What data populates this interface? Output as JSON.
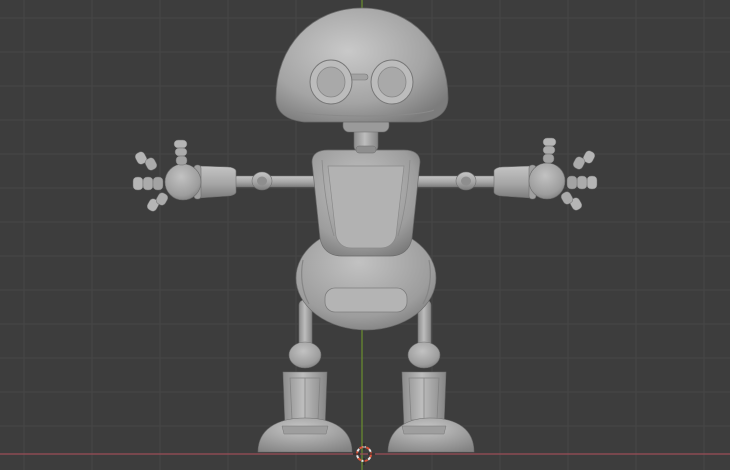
{
  "viewport": {
    "background_color": "#3d3d3d",
    "grid_color": "#474747",
    "axis_x_color": "#9b4e57",
    "axis_z_color": "#6b8f2e",
    "model_color": "#a8a8a8",
    "model_shadow_color": "#7a7a7a",
    "model_highlight_color": "#c9c9c9",
    "cursor_color": "#d9543a",
    "icons": {
      "cursor": "3d-cursor-icon"
    }
  }
}
